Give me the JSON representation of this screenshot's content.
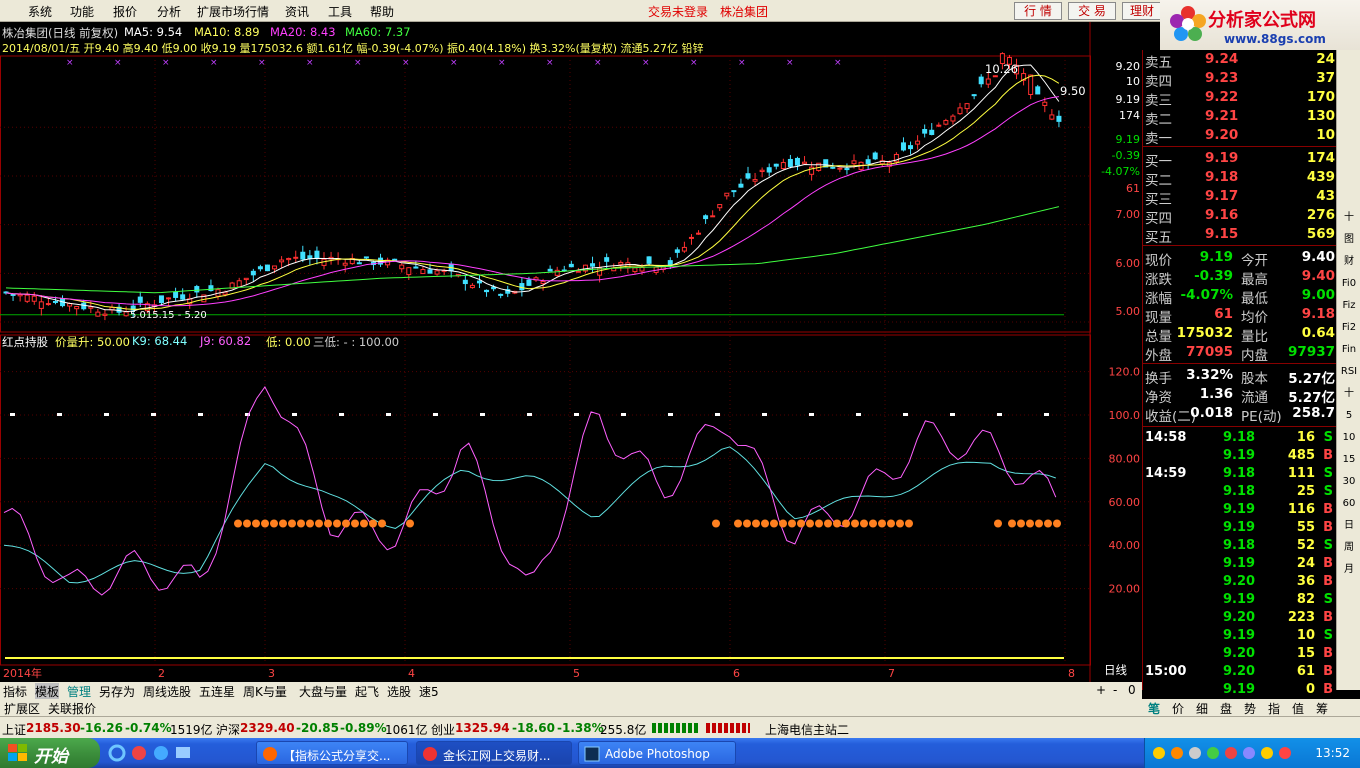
{
  "menu": [
    "系统",
    "功能",
    "报价",
    "分析",
    "扩展市场行情",
    "资讯",
    "工具",
    "帮助"
  ],
  "login_status": "交易未登录",
  "stock_name": "株冶集团",
  "top_buttons": [
    "行 情",
    "交 易",
    "理财"
  ],
  "logo": {
    "title": "分析家公式网",
    "url": "www.88gs.com"
  },
  "header": {
    "title": "株冶集团(日线 前复权)",
    "ma5": "MA5: 9.54",
    "ma10": "MA10: 8.89",
    "ma20": "MA20: 8.43",
    "ma60": "MA60: 7.37",
    "info_line": "2014/08/01/五 开9.40 高9.40 低9.00 收9.19 量175032.6 额1.61亿 幅-0.39(-4.07%) 振0.40(4.18%) 换3.32%(量复权) 流通5.27亿 铅锌"
  },
  "price_axis": [
    "9.20",
    "10",
    "9.19",
    "174",
    "9.19",
    "-0.39",
    "-4.07%",
    "61",
    "7.00",
    "6.00",
    "5.00"
  ],
  "annotations": {
    "high": "10.26",
    "right_price": "9.50",
    "low_range": "5.015.15 - 5.20"
  },
  "indicator": {
    "name": "红点持股",
    "l1": "价量升: 50.00",
    "l2": "K9: 68.44",
    "l3": "J9: 60.82",
    "l4": "低: 0.00",
    "l5": "三低: - : 100.00"
  },
  "ind_axis": [
    "120.0",
    "100.0",
    "80.00",
    "60.00",
    "40.00",
    "20.00"
  ],
  "x_axis": [
    "2014年",
    "2",
    "3",
    "4",
    "5",
    "6",
    "7",
    "8"
  ],
  "x_axis_right": "日线",
  "chart_data": {
    "type": "line",
    "x": [
      "2014-01",
      "2014-02",
      "2014-03",
      "2014-04",
      "2014-05",
      "2014-06",
      "2014-07",
      "2014-08"
    ],
    "series": [
      {
        "name": "K9",
        "values": [
          40,
          25,
          30,
          30,
          80,
          60,
          50,
          75,
          70,
          55,
          75,
          85,
          55,
          60,
          70,
          80,
          68
        ]
      },
      {
        "name": "J9",
        "values": [
          55,
          20,
          30,
          22,
          120,
          50,
          45,
          85,
          15,
          100,
          65,
          100,
          45,
          60,
          90,
          85,
          61
        ]
      }
    ],
    "price": {
      "ylim": [
        5.0,
        10.3
      ],
      "values": [
        5.6,
        5.4,
        5.2,
        5.5,
        5.7,
        6.3,
        6.3,
        6.2,
        6.0,
        5.5,
        6.1,
        6.2,
        6.2,
        7.6,
        8.3,
        8.2,
        8.3,
        9.2,
        10.26,
        9.19
      ]
    },
    "ma60": {
      "values": [
        5.7,
        5.65,
        5.6,
        5.7,
        5.8,
        5.9,
        5.95,
        6.0,
        6.1,
        6.15,
        6.2,
        6.4,
        6.7,
        7.0,
        7.37
      ]
    }
  },
  "quote": {
    "sell": [
      {
        "l": "卖五",
        "p": "9.24",
        "v": "24"
      },
      {
        "l": "卖四",
        "p": "9.23",
        "v": "37"
      },
      {
        "l": "卖三",
        "p": "9.22",
        "v": "170"
      },
      {
        "l": "卖二",
        "p": "9.21",
        "v": "130"
      },
      {
        "l": "卖一",
        "p": "9.20",
        "v": "10"
      }
    ],
    "buy": [
      {
        "l": "买一",
        "p": "9.19",
        "v": "174"
      },
      {
        "l": "买二",
        "p": "9.18",
        "v": "439"
      },
      {
        "l": "买三",
        "p": "9.17",
        "v": "43"
      },
      {
        "l": "买四",
        "p": "9.16",
        "v": "276"
      },
      {
        "l": "买五",
        "p": "9.15",
        "v": "569"
      }
    ],
    "stats": [
      [
        "现价",
        "9.19",
        "今开",
        "9.40"
      ],
      [
        "涨跌",
        "-0.39",
        "最高",
        "9.40"
      ],
      [
        "涨幅",
        "-4.07%",
        "最低",
        "9.00"
      ],
      [
        "现量",
        "61",
        "均价",
        "9.18"
      ],
      [
        "总量",
        "175032",
        "量比",
        "0.64"
      ],
      [
        "外盘",
        "77095",
        "内盘",
        "97937"
      ],
      [
        "换手",
        "3.32%",
        "股本",
        "5.27亿"
      ],
      [
        "净资",
        "1.36",
        "流通",
        "5.27亿"
      ],
      [
        "收益(二)",
        "0.018",
        "PE(动)",
        "258.7"
      ]
    ],
    "ticks": [
      {
        "t": "14:58",
        "p": "9.18",
        "v": "16",
        "s": "S"
      },
      {
        "t": "",
        "p": "9.19",
        "v": "485",
        "s": "B"
      },
      {
        "t": "14:59",
        "p": "9.18",
        "v": "111",
        "s": "S"
      },
      {
        "t": "",
        "p": "9.18",
        "v": "25",
        "s": "S"
      },
      {
        "t": "",
        "p": "9.19",
        "v": "116",
        "s": "B"
      },
      {
        "t": "",
        "p": "9.19",
        "v": "55",
        "s": "B"
      },
      {
        "t": "",
        "p": "9.18",
        "v": "52",
        "s": "S"
      },
      {
        "t": "",
        "p": "9.19",
        "v": "24",
        "s": "B"
      },
      {
        "t": "",
        "p": "9.20",
        "v": "36",
        "s": "B"
      },
      {
        "t": "",
        "p": "9.19",
        "v": "82",
        "s": "S"
      },
      {
        "t": "",
        "p": "9.20",
        "v": "223",
        "s": "B"
      },
      {
        "t": "",
        "p": "9.19",
        "v": "10",
        "s": "S"
      },
      {
        "t": "",
        "p": "9.20",
        "v": "15",
        "s": "B"
      },
      {
        "t": "15:00",
        "p": "9.20",
        "v": "61",
        "s": "B"
      },
      {
        "t": "",
        "p": "9.19",
        "v": "0",
        "s": "B"
      }
    ]
  },
  "right_tools": [
    "十",
    "图",
    "财",
    "Fi0",
    "Fiz",
    "Fi2",
    "Fin",
    "RSI",
    "十",
    "5",
    "10",
    "15",
    "30",
    "60",
    "日",
    "周",
    "月"
  ],
  "tabs": [
    "指标",
    "模板",
    "管理",
    "另存为",
    "周线选股",
    "五连星",
    "周K与量",
    "大盘与量",
    "起飞",
    "选股",
    "速5"
  ],
  "tabs2": [
    "扩展区",
    "关联报价"
  ],
  "bottom_tabs": [
    "笔",
    "价",
    "细",
    "盘",
    "势",
    "指",
    "值",
    "筹"
  ],
  "status": {
    "sh": "上证",
    "sh_val": "2185.30",
    "sh_chg": "-16.26",
    "sh_pct": "-0.74%",
    "sh_amt": "1519亿",
    "hs": "沪深",
    "hs_val": "2329.40",
    "hs_chg": "-20.85",
    "hs_pct": "-0.89%",
    "hs_amt": "1061亿",
    "cy": "创业",
    "cy_val": "1325.94",
    "cy_chg": "-18.60",
    "cy_pct": "-1.38%",
    "cy_amt": "255.8亿",
    "server": "上海电信主站二"
  },
  "taskbar": {
    "start": "开始",
    "tasks": [
      "【指标公式分享交...",
      "金长江网上交易财...",
      "Adobe Photoshop"
    ],
    "clock": "13:52"
  }
}
